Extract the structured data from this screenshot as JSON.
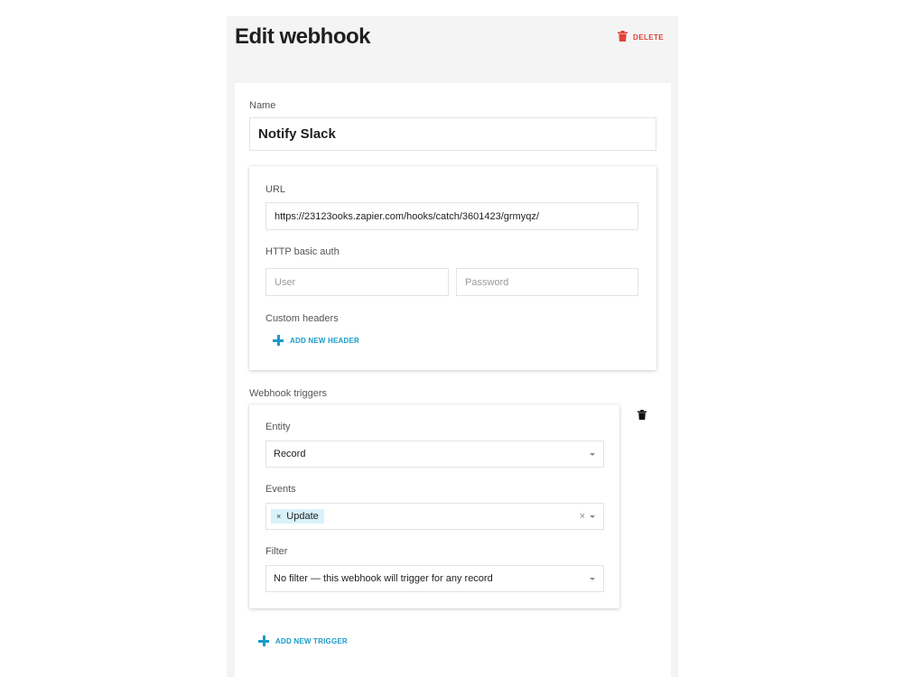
{
  "header": {
    "title": "Edit webhook",
    "delete_label": "DELETE"
  },
  "form": {
    "name_label": "Name",
    "name_value": "Notify Slack",
    "url_label": "URL",
    "url_value": "https://23123ooks.zapier.com/hooks/catch/3601423/grmyqz/",
    "auth_label": "HTTP basic auth",
    "user_placeholder": "User",
    "password_placeholder": "Password",
    "headers_label": "Custom headers",
    "add_header_label": "ADD NEW HEADER"
  },
  "triggers": {
    "section_label": "Webhook triggers",
    "entity_label": "Entity",
    "entity_value": "Record",
    "events_label": "Events",
    "events_tag": "Update",
    "tag_remove": "×",
    "clear": "×",
    "filter_label": "Filter",
    "filter_value": "No filter — this webhook will trigger for any record",
    "add_trigger_label": "ADD NEW TRIGGER"
  },
  "colors": {
    "accent": "#1a9bc7",
    "danger": "#e0423a",
    "tag_bg": "#d9f2fa"
  },
  "icons": {
    "delete": "trash-icon",
    "add": "plus-icon",
    "remove_trigger": "trash-icon"
  }
}
